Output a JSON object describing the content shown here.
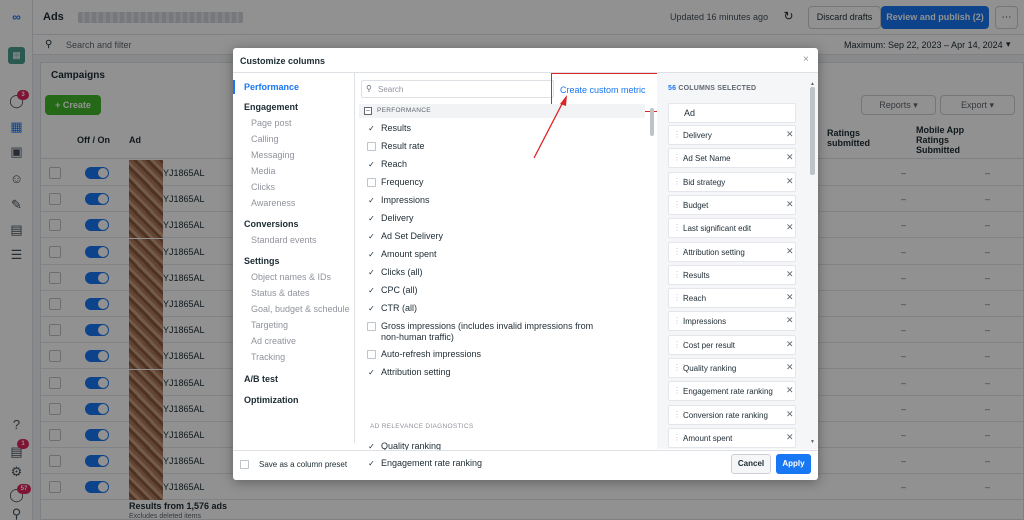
{
  "app": {
    "title": "Ads",
    "updated": "Updated 16 minutes ago",
    "discard_label": "Discard drafts",
    "publish_label": "Review and publish (2)",
    "more_label": "⋯",
    "search_placeholder": "Search and filter",
    "date_range": "Maximum: Sep 22, 2023 – Apr 14, 2024",
    "campaigns_tab": "Campaigns",
    "create_label": "+ Create",
    "reports_label": "Reports ▾",
    "export_label": "Export ▾",
    "col_off_on": "Off / On",
    "col_ad": "Ad",
    "col_ratings": "Ratings submitted",
    "col_mobile": "Mobile App Ratings Submitted",
    "row_names": [
      "YJ1865AL",
      "YJ1865AL",
      "YJ1865AL",
      "YJ1865AL",
      "YJ1865AL",
      "YJ1865AL",
      "YJ1865AL",
      "YJ1865AL",
      "YJ1865AL",
      "YJ1865AL",
      "YJ1865AL",
      "YJ1865AL",
      "YJ1865AL"
    ],
    "row_dash": "–",
    "results_footer": "Results from 1,576 ads",
    "results_sub": "Excludes deleted items",
    "rail_badges": [
      "3",
      "1",
      "57"
    ]
  },
  "modal": {
    "title": "Customize columns",
    "close_label": "×",
    "nav": {
      "performance": "Performance",
      "engagement": "Engagement",
      "engagement_items": [
        "Page post",
        "Calling",
        "Messaging",
        "Media",
        "Clicks",
        "Awareness"
      ],
      "conversions": "Conversions",
      "conversions_items": [
        "Standard events"
      ],
      "settings": "Settings",
      "settings_items": [
        "Object names & IDs",
        "Status & dates",
        "Goal, budget & schedule",
        "Targeting",
        "Ad creative",
        "Tracking"
      ],
      "ab_test": "A/B test",
      "optimization": "Optimization"
    },
    "search_placeholder": "Search",
    "custom_metric_label": "Create custom metric",
    "performance_header": "PERFORMANCE",
    "metrics": [
      {
        "label": "Results",
        "checked": true
      },
      {
        "label": "Result rate",
        "checked": false
      },
      {
        "label": "Reach",
        "checked": true
      },
      {
        "label": "Frequency",
        "checked": false
      },
      {
        "label": "Impressions",
        "checked": true
      },
      {
        "label": "Delivery",
        "checked": true
      },
      {
        "label": "Ad Set Delivery",
        "checked": true
      },
      {
        "label": "Amount spent",
        "checked": true
      },
      {
        "label": "Clicks (all)",
        "checked": true
      },
      {
        "label": "CPC (all)",
        "checked": true
      },
      {
        "label": "CTR (all)",
        "checked": true
      },
      {
        "label": "Gross impressions (includes invalid impressions from non-human traffic)",
        "checked": false
      },
      {
        "label": "Auto-refresh impressions",
        "checked": false
      },
      {
        "label": "Attribution setting",
        "checked": true
      }
    ],
    "diagnostics_header": "AD RELEVANCE DIAGNOSTICS",
    "diagnostics": [
      {
        "label": "Quality ranking",
        "checked": true
      },
      {
        "label": "Engagement rate ranking",
        "checked": true
      }
    ],
    "selected_count": "56",
    "selected_count_label": "COLUMNS SELECTED",
    "selected_fixed": "Ad",
    "selected": [
      "Delivery",
      "Ad Set Name",
      "Bid strategy",
      "Budget",
      "Last significant edit",
      "Attribution setting",
      "Results",
      "Reach",
      "Impressions",
      "Cost per result",
      "Quality ranking",
      "Engagement rate ranking",
      "Conversion rate ranking",
      "Amount spent"
    ],
    "save_preset_label": "Save as a column preset",
    "cancel_label": "Cancel",
    "apply_label": "Apply"
  },
  "colors": {
    "accent": "#1877f2",
    "create_green": "#42b72a",
    "annotation_red": "#e02424"
  }
}
